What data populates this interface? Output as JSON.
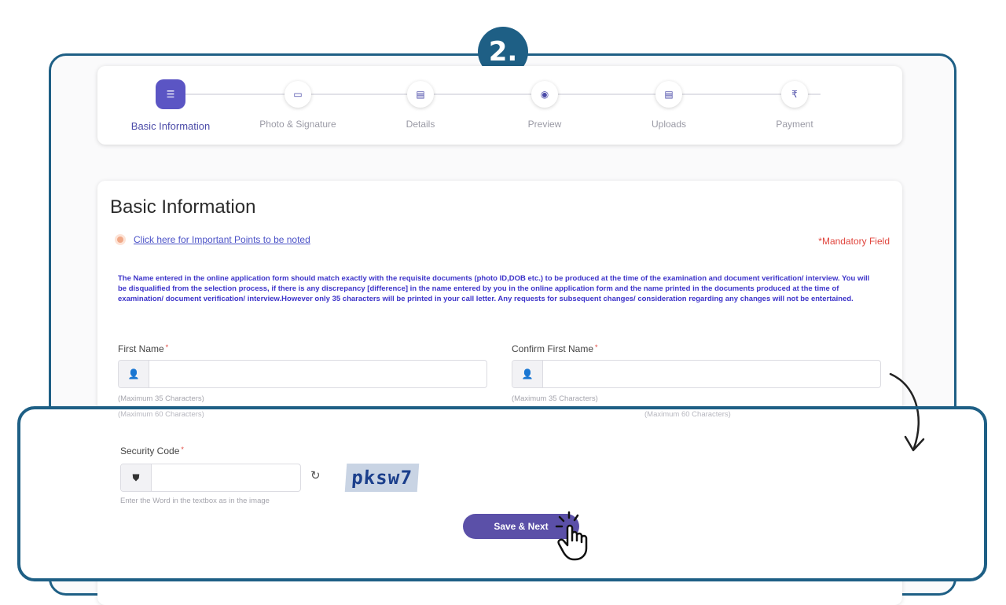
{
  "step_number": "2.",
  "stepper": {
    "steps": [
      {
        "label": "Basic Information",
        "icon": "list-icon",
        "glyph": "☰",
        "active": true
      },
      {
        "label": "Photo & Signature",
        "icon": "image-icon",
        "glyph": "▭",
        "active": false
      },
      {
        "label": "Details",
        "icon": "document-icon",
        "glyph": "▤",
        "active": false
      },
      {
        "label": "Preview",
        "icon": "eye-icon",
        "glyph": "◉",
        "active": false
      },
      {
        "label": "Uploads",
        "icon": "upload-icon",
        "glyph": "▤",
        "active": false
      },
      {
        "label": "Payment",
        "icon": "rupee-icon",
        "glyph": "₹",
        "active": false
      }
    ]
  },
  "form": {
    "title": "Basic Information",
    "points_link": "Click here for Important Points to be noted",
    "mandatory": "*Mandatory Field",
    "notice": "The Name entered in the online application form should match exactly with the requisite documents (photo ID,DOB etc.) to be produced at the time of the examination and document verification/ interview. You will be disqualified from the selection process, if there is any discrepancy [difference] in the name entered by you in the online application form and the name printed in the documents produced at the time of examination/ document verification/ interview.However only 35 characters will be printed in your call letter. Any requests for subsequent changes/ consideration regarding any changes will not be entertained.",
    "first_name": {
      "label": "First Name",
      "hint": "(Maximum 35 Characters)",
      "value": ""
    },
    "confirm_first_name": {
      "label": "Confirm First Name",
      "hint": "(Maximum 35 Characters)",
      "value": ""
    },
    "faded_hint_left": "(Maximum 60 Characters)",
    "faded_hint_right": "(Maximum 60 Characters)",
    "security_code": {
      "label": "Security Code",
      "hint": "Enter the Word in the textbox as in the image",
      "captcha": "pksw7",
      "value": ""
    },
    "save_button": "Save & Next"
  },
  "colors": {
    "accent": "#5b55c4",
    "frame": "#1e5f85",
    "mandatory": "#e0453d"
  }
}
